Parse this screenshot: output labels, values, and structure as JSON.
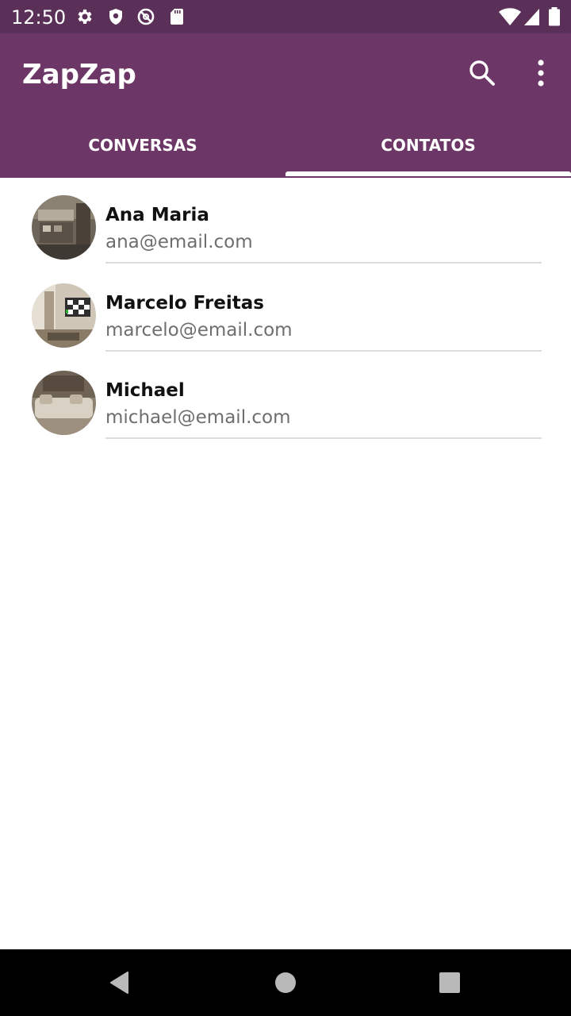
{
  "status_bar": {
    "time": "12:50",
    "left_icons": [
      "gear-icon",
      "shield-icon",
      "no-sync-icon",
      "sd-card-icon"
    ],
    "right_icons": [
      "wifi-icon",
      "cell-signal-icon",
      "battery-icon"
    ]
  },
  "app_bar": {
    "title": "ZapZap",
    "actions": [
      "search-icon",
      "more-vert-icon"
    ],
    "color": "#6c3766"
  },
  "tabs": [
    {
      "label": "CONVERSAS",
      "selected": false
    },
    {
      "label": "CONTATOS",
      "selected": true
    }
  ],
  "contacts": [
    {
      "name": "Ana Maria",
      "email": "ana@email.com"
    },
    {
      "name": "Marcelo Freitas",
      "email": "marcelo@email.com"
    },
    {
      "name": "Michael",
      "email": "michael@email.com"
    }
  ],
  "nav_bar": {
    "buttons": [
      "back-icon",
      "home-icon",
      "recents-icon"
    ]
  }
}
